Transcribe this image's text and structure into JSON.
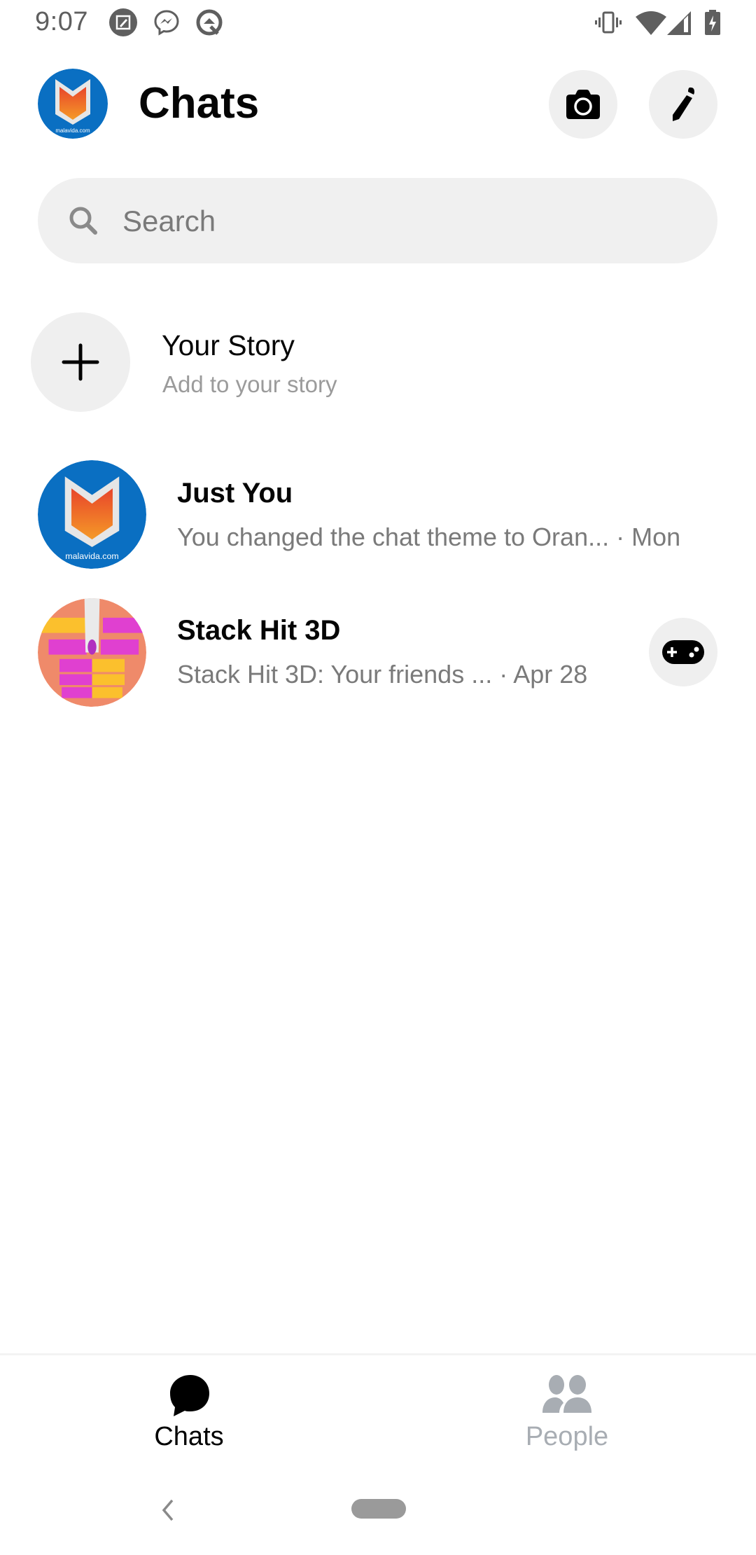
{
  "status_bar": {
    "time": "9:07",
    "left_icons": [
      "screenshot-edit-icon",
      "messenger-icon",
      "android-q-icon"
    ],
    "right_icons": [
      "vibrate-icon",
      "wifi-icon",
      "cell-signal-icon",
      "battery-charging-icon"
    ]
  },
  "header": {
    "title": "Chats",
    "profile_avatar_text": "malavida.com",
    "camera_icon": "camera-icon",
    "compose_icon": "pencil-icon"
  },
  "search": {
    "placeholder": "Search",
    "value": ""
  },
  "story": {
    "title": "Your Story",
    "subtitle": "Add to your story"
  },
  "chats": [
    {
      "name": "Just You",
      "preview": "You changed the chat theme to Oran...",
      "time": "Mon",
      "avatar_text": "malavida.com"
    },
    {
      "name": "Stack Hit 3D",
      "preview": "Stack Hit 3D: Your friends ...",
      "time": "Apr 28",
      "action_icon": "game-controller-icon"
    }
  ],
  "separator": "·",
  "bottom_nav": {
    "tabs": [
      {
        "label": "Chats",
        "icon": "chat-bubble-icon",
        "active": true,
        "color": "#000000"
      },
      {
        "label": "People",
        "icon": "people-icon",
        "active": false,
        "color": "#a8adb3"
      }
    ]
  },
  "colors": {
    "brand_blue": "#0a6fc2",
    "logo_orange": "#f0642a",
    "secondary_text": "#7a7a7a",
    "button_bg": "#efefef"
  }
}
